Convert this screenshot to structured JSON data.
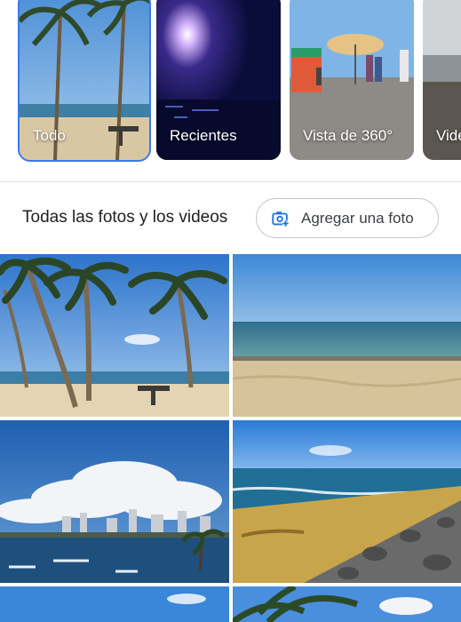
{
  "categories": [
    {
      "label": "Todo",
      "selected": true
    },
    {
      "label": "Recientes",
      "selected": false
    },
    {
      "label": "Vista de 360°",
      "selected": false
    },
    {
      "label": "Vide",
      "selected": false
    }
  ],
  "section": {
    "title": "Todas las fotos y los videos",
    "add_photo_label": "Agregar una foto"
  },
  "colors": {
    "accent": "#3b78e7",
    "icon_blue": "#1a73e8"
  },
  "photos": [
    {
      "name": "palm-trees-beach"
    },
    {
      "name": "sandy-beach-sea"
    },
    {
      "name": "clouds-coastline-city"
    },
    {
      "name": "rocky-shore"
    },
    {
      "name": "sky-partial-left"
    },
    {
      "name": "palm-partial-right"
    }
  ]
}
